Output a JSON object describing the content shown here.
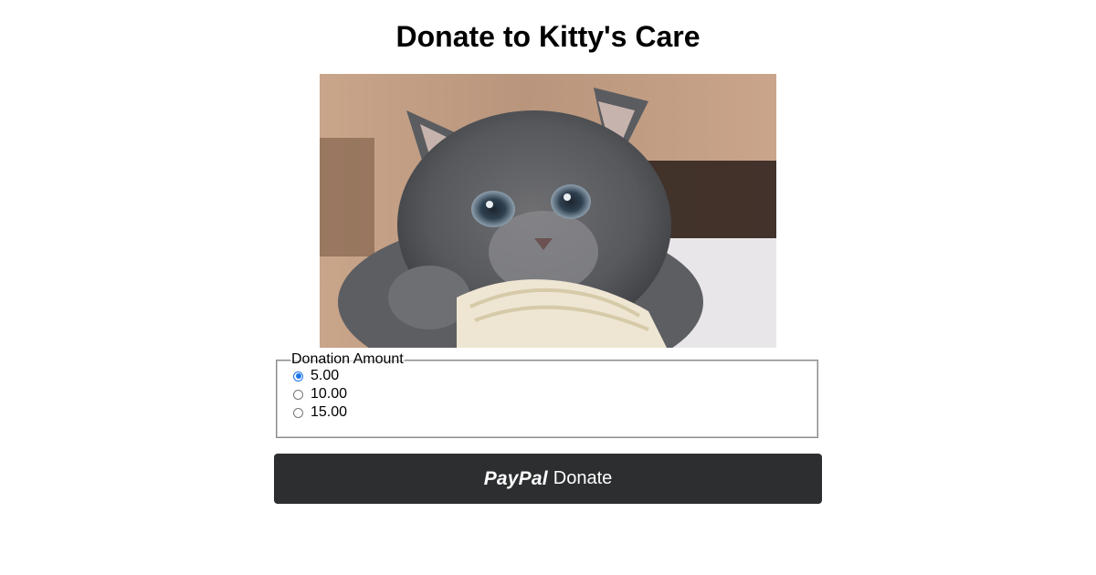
{
  "page": {
    "title": "Donate to Kitty's Care"
  },
  "image": {
    "subject": "kitten-photo"
  },
  "donation": {
    "legend": "Donation Amount",
    "options": [
      {
        "label": "5.00",
        "checked": true
      },
      {
        "label": "10.00",
        "checked": false
      },
      {
        "label": "15.00",
        "checked": false
      }
    ]
  },
  "paypal_button": {
    "brand": "PayPal",
    "label": "Donate",
    "background_color": "#2c2e2f"
  },
  "colors": {
    "radio_accent": "#1a73e8"
  }
}
